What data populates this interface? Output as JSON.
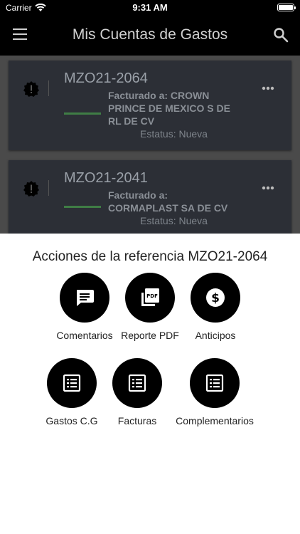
{
  "status_bar": {
    "carrier": "Carrier",
    "time": "9:31 AM"
  },
  "app_bar": {
    "title": "Mis Cuentas de Gastos",
    "menu_icon": "menu-icon",
    "search_icon": "search-icon"
  },
  "cards": [
    {
      "ref": "MZO21-2064",
      "billed_line1": "Facturado a: CROWN",
      "billed_line2": "PRINCE DE MEXICO S DE",
      "billed_line3": "RL DE CV",
      "status": "Estatus: Nueva"
    },
    {
      "ref": "MZO21-2041",
      "billed_line1": "Facturado a:",
      "billed_line2": "CORMAPLAST SA DE CV",
      "status": "Estatus: Nueva"
    }
  ],
  "sheet": {
    "title": "Acciones de la referencia MZO21-2064",
    "actions": [
      {
        "label": "Comentarios",
        "icon": "comment-icon"
      },
      {
        "label": "Reporte PDF",
        "icon": "pdf-icon"
      },
      {
        "label": "Anticipos",
        "icon": "dollar-icon"
      },
      {
        "label": "Gastos C.G",
        "icon": "list-icon"
      },
      {
        "label": "Facturas",
        "icon": "list-icon"
      },
      {
        "label": "Complementarios",
        "icon": "list-icon"
      }
    ]
  },
  "colors": {
    "accent_bar": "#3f7d45",
    "app_bar": "#000000",
    "card_bg": "#2c2f36"
  }
}
